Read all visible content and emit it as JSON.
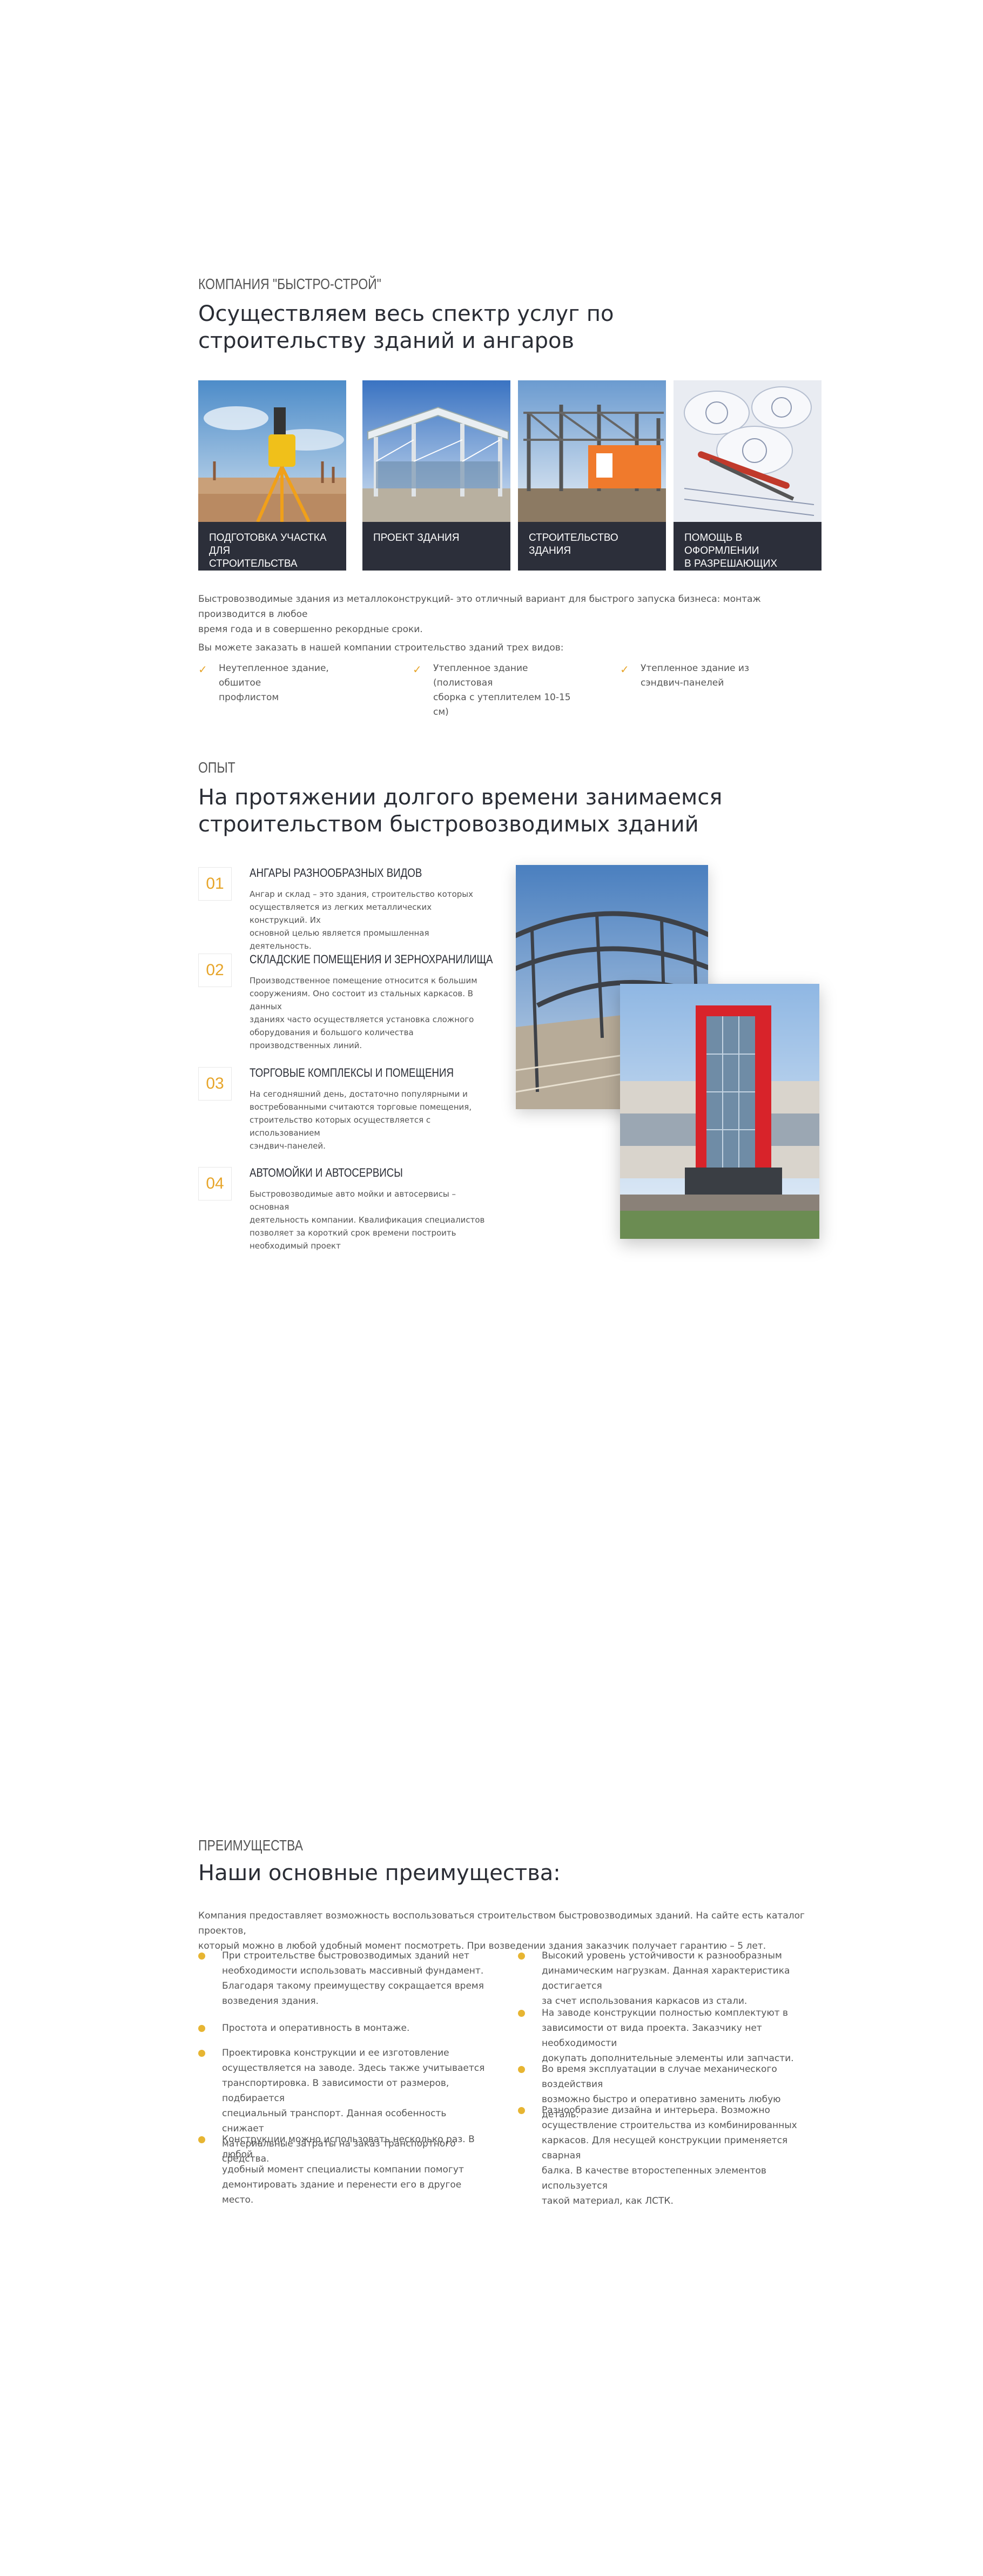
{
  "services": {
    "eyebrow": "КОМПАНИЯ \"БЫСТРО-СТРОЙ\"",
    "title_line1": "Осуществляем весь спектр услуг по",
    "title_line2": "строительству зданий и ангаров",
    "cards": [
      {
        "caption_line1": "ПОДГОТОВКА УЧАСТКА ДЛЯ",
        "caption_line2": "СТРОИТЕЛЬСТВА"
      },
      {
        "caption_line1": "ПРОЕКТ ЗДАНИЯ",
        "caption_line2": ""
      },
      {
        "caption_line1": "СТРОИТЕЛЬСТВО ЗДАНИЯ",
        "caption_line2": ""
      },
      {
        "caption_line1": "ПОМОЩЬ В ОФОРМЛЕНИИ",
        "caption_line2": "В РАЗРЕШАЮЩИХ ОРГАНАХ"
      }
    ],
    "text_line1": "Быстровозводимые здания из металлоконструкций- это отличный вариант для быстрого запуска бизнеса: монтаж производится в любое",
    "text_line2": "время года и в совершенно рекордные сроки.",
    "text_line3": " Вы можете заказать в нашей компании строительство зданий трех видов:",
    "checks": [
      {
        "line1": "Неутепленное здание, обшитое",
        "line2": "профлистом"
      },
      {
        "line1": "Утепленное здание (полистовая",
        "line2": "сборка с утеплителем 10-15 см)"
      },
      {
        "line1": "Утепленное здание из",
        "line2": "сэндвич-панелей"
      }
    ],
    "accent_color": "#e7a52a"
  },
  "experience": {
    "eyebrow": "ОПЫТ",
    "title_line1": "На протяжении долгого времени занимаемся",
    "title_line2": "строительством быстровозводимых зданий",
    "items": [
      {
        "num": "01",
        "title": "АНГАРЫ РАЗНООБРАЗНЫХ ВИДОВ",
        "lines": [
          "Ангар и склад – это здания, строительство которых",
          "осуществляется из легких металлических конструкций. Их",
          "основной целью является промышленная деятельность."
        ]
      },
      {
        "num": "02",
        "title": "СКЛАДСКИЕ ПОМЕЩЕНИЯ И ЗЕРНОХРАНИЛИЩА",
        "lines": [
          "Производственное помещение относится к большим",
          "сооружениям. Оно состоит из стальных каркасов. В данных",
          "зданиях часто осуществляется установка сложного",
          "оборудования и большого количества",
          "производственных линий."
        ]
      },
      {
        "num": "03",
        "title": "ТОРГОВЫЕ КОМПЛЕКСЫ И ПОМЕЩЕНИЯ",
        "lines": [
          "На сегодняшний день, достаточно популярными и",
          "востребованными считаются торговые помещения,",
          "строительство которых осуществляется с использованием",
          "сэндвич-панелей."
        ]
      },
      {
        "num": "04",
        "title": "АВТОМОЙКИ И АВТОСЕРВИСЫ",
        "lines": [
          "Быстровозводимые авто мойки и автосервисы – основная",
          "деятельность компании. Квалификация специалистов",
          "позволяет за короткий срок времени построить",
          "необходимый проект"
        ]
      }
    ]
  },
  "advantages": {
    "eyebrow": "ПРЕИМУЩЕСТВА",
    "title": "Наши основные преимущества:",
    "intro_line1": "Компания предоставляет возможность воспользоваться строительством быстровозводимых зданий. На сайте есть каталог проектов,",
    "intro_line2": "который можно в любой удобный момент посмотреть. При возведении здания заказчик получает гарантию – 5 лет.",
    "left": [
      {
        "lines": [
          "При строительстве быстровозводимых зданий нет",
          "необходимости использовать массивный фундамент.",
          "Благодаря такому преимуществу сокращается время",
          "возведения здания."
        ]
      },
      {
        "lines": [
          "Простота и оперативность в монтаже."
        ]
      },
      {
        "lines": [
          "Проектировка конструкции и ее изготовление",
          "осуществляется на заводе. Здесь также учитывается",
          "транспортировка. В зависимости от размеров, подбирается",
          "специальный транспорт. Данная особенность снижает",
          "материальные затраты на заказ транспортного средства."
        ]
      },
      {
        "lines": [
          "Конструкции можно использовать несколько раз. В любой",
          "удобный момент специалисты компании помогут",
          "демонтировать здание и перенести его в другое место."
        ]
      }
    ],
    "right": [
      {
        "lines": [
          "Высокий уровень устойчивости к разнообразным",
          "динамическим нагрузкам. Данная характеристика достигается",
          "за счет использования каркасов из стали."
        ]
      },
      {
        "lines": [
          "На заводе конструкции полностью комплектуют в",
          "зависимости от вида проекта. Заказчику нет необходимости",
          "докупать дополнительные элементы или запчасти."
        ]
      },
      {
        "lines": [
          "Во время эксплуатации в случае механического воздействия",
          "возможно быстро и оперативно заменить любую деталь."
        ]
      },
      {
        "lines": [
          "Разнообразие дизайна и интерьера. Возможно",
          "осуществление строительства из комбинированных",
          "каркасов. Для несущей конструкции применяется сварная",
          "балка. В качестве второстепенных элементов используется",
          "такой материал, как ЛСТК."
        ]
      }
    ],
    "bullet_color": "#e7b532"
  }
}
